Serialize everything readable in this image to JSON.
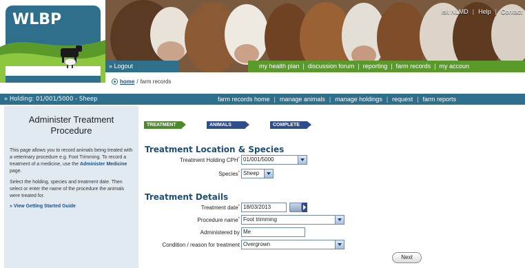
{
  "logo": {
    "text": "WLBP"
  },
  "top_links": {
    "visit": "isit NLMD",
    "help": "Help",
    "contact": "Contact"
  },
  "header": {
    "logout": "» Logout",
    "nav": [
      "my health plan",
      "discussion forum",
      "reporting",
      "farm records",
      "my accoun"
    ]
  },
  "breadcrumb": {
    "home": "home",
    "current": "farm records"
  },
  "subbar": {
    "holding": "» Holding: 01/001/5000 - Sheep",
    "links": [
      "farm records home",
      "manage animals",
      "manage holdings",
      "request",
      "farm reports"
    ]
  },
  "sidebar": {
    "title": "Administer Treatment Procedure",
    "p1_text": "This page allows you to record animals being treated with a veterinary procedure e.g. Foot Trimming. To record a treatment of a medicine, use the",
    "p1_link": "Administer Medicine",
    "p1_end": "page.",
    "p2": "Select the holding, species and treatment date. Then select or enter the name of the procedure the animals were treated for.",
    "guide": "» View Getting Started Guide"
  },
  "steps": [
    "TREATMENT",
    "ANIMALS",
    "COMPLETE"
  ],
  "location": {
    "heading": "Treatment Location & Species",
    "cph_label": "Treatment Holding CPH",
    "cph_value": "01/001/5000",
    "species_label": "Species",
    "species_value": "Sheep"
  },
  "details": {
    "heading": "Treatment Details",
    "date_label": "Treatment date",
    "date_value": "18/03/2013",
    "procedure_label": "Procedure name",
    "procedure_value": "Foot trimming",
    "administered_label": "Administered by",
    "administered_value": "Me",
    "reason_label": "Condition / reason for treatment",
    "reason_value": "Overgrown"
  },
  "actions": {
    "next": "Next"
  },
  "colors": {
    "brand_blue": "#2e6f8c",
    "nav_green": "#5a9a2a",
    "heading_blue": "#1e4e76"
  }
}
